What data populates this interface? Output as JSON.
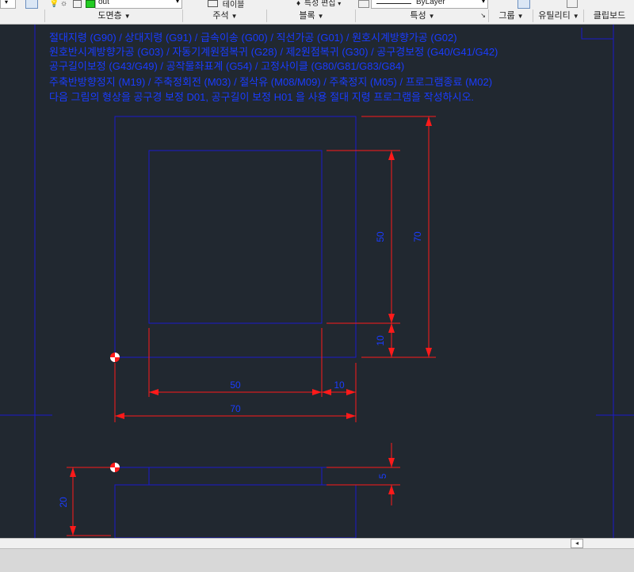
{
  "ribbon": {
    "layer_name": "out",
    "table_label": "테이블",
    "match_properties_label": "특성 편집",
    "linetype_value": "ByLayer",
    "panels": [
      {
        "key": "layers",
        "label": "도면층"
      },
      {
        "key": "annotation",
        "label": "주석"
      },
      {
        "key": "block",
        "label": "블록"
      },
      {
        "key": "properties",
        "label": "특성"
      },
      {
        "key": "groups",
        "label": "그룹"
      },
      {
        "key": "utilities",
        "label": "유틸리티"
      },
      {
        "key": "clipboard",
        "label": "클립보드"
      }
    ]
  },
  "drawing": {
    "text_lines": [
      "절대지령 (G90) / 상대지령 (G91) / 급속이송 (G00) / 직선가공 (G01) / 원호시계방향가공 (G02)",
      "원호반시계방향가공 (G03) / 자동기계원점복귀 (G28) / 제2원점복귀 (G30) / 공구경보정 (G40/G41/G42)",
      "공구길이보정 (G43/G49) / 공작물좌표계 (G54) / 고정사이클 (G80/G81/G83/G84)",
      "주축반방향정지 (M19) / 주축정회전 (M03) / 절삭유 (M08/M09) / 주축정지 (M05) / 프로그램종료 (M02)",
      "다음 그림의 형상을 공구경 보정 D01, 공구길이 보정 H01 을 사용 절대 지령 프로그램을 작성하시오."
    ],
    "dims": {
      "inner_height": "50",
      "outer_height": "70",
      "offset_bottom": "10",
      "inner_width": "50",
      "offset_right": "10",
      "outer_width": "70",
      "step_depth": "5",
      "total_depth": "20"
    }
  },
  "colors": {
    "background": "#212830",
    "geometry": "#1a1acc",
    "dimension": "#ff1a1a",
    "text": "#1a3cff"
  }
}
